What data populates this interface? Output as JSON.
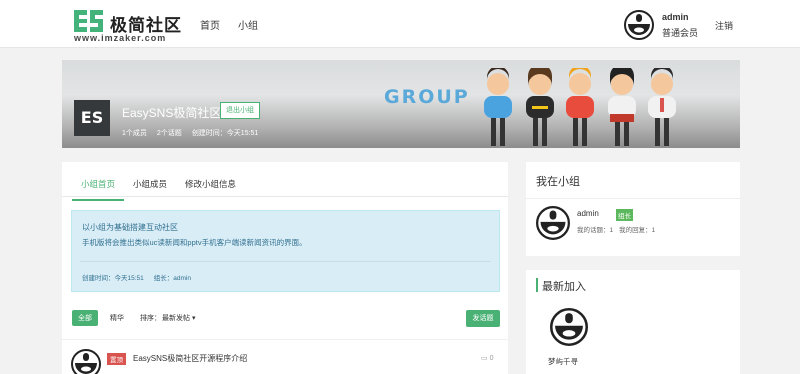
{
  "header": {
    "logo_text": "极简社区",
    "logo_url": "www.imzaker.com",
    "nav": [
      "首页",
      "小组"
    ],
    "user": {
      "name": "admin",
      "role": "普通会员"
    },
    "logout": "注销"
  },
  "banner": {
    "word": "GROUP",
    "group_logo": "ES",
    "group_name": "EasySNS极简社区",
    "leave_button": "退出小组",
    "stats": [
      "1个成员",
      "2个话题",
      "创建时间：今天15:51"
    ]
  },
  "tabs": [
    "小组首页",
    "小组成员",
    "修改小组信息"
  ],
  "intro": {
    "title": "以小组为基础搭建互动社区",
    "description": "手机版将会推出类似uc读新闻和pptv手机客户端读新闻资讯的界面。",
    "created": "创建时间：今天15:51",
    "owner": "组长：admin"
  },
  "filter": {
    "all": "全部",
    "featured": "精华",
    "sort_prefix": "排序：",
    "sort_value": "最新发帖 ▾",
    "post_button": "发话题"
  },
  "topics": [
    {
      "badge": "置顶",
      "title": "EasySNS极简社区开源程序介绍",
      "comments": "0"
    }
  ],
  "my_group": {
    "title": "我在小组",
    "name": "admin",
    "badge": "组长",
    "stats": [
      "我的话题：1",
      "我的回复：1"
    ]
  },
  "new_members": {
    "title": "最新加入",
    "members": [
      "梦屿千寻"
    ]
  },
  "colors": {
    "accent": "#4ab174",
    "info_bg": "#d9edf7",
    "danger": "#d9534f"
  }
}
